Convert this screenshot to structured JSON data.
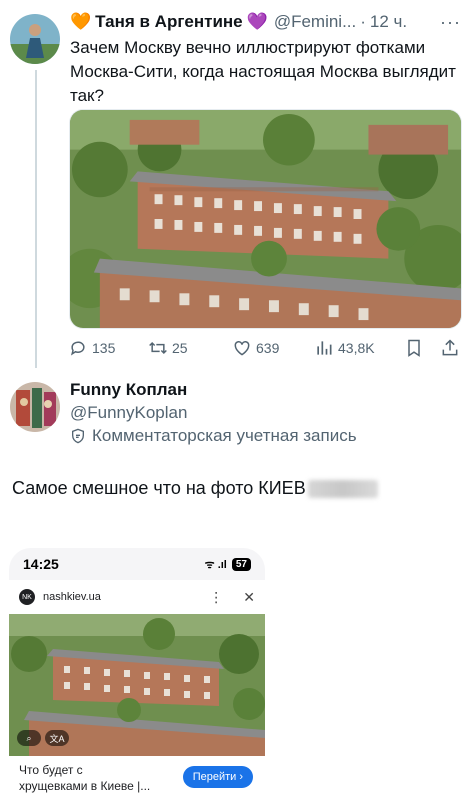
{
  "tweet1": {
    "emoji_left": "🧡",
    "display_name": "Таня в Аргентине",
    "emoji_right": "💜",
    "handle": "@Femini...",
    "separator": "·",
    "time": "12 ч.",
    "more_label": "···",
    "text": "Зачем Москву вечно иллюстрируют фотками Москва-Сити, когда настоящая Москва выглядит так?",
    "stats": {
      "replies": "135",
      "retweets": "25",
      "likes": "639",
      "views": "43,8K"
    }
  },
  "tweet2": {
    "display_name": "Funny Коплан",
    "handle": "@FunnyKoplan",
    "account_label": "Комментаторская учетная запись",
    "text": "Самое смешное что на фото КИЕВ"
  },
  "phone": {
    "time": "14:25",
    "signal": "ᯤ .ıl",
    "battery": "57",
    "site": "nashkiev.ua",
    "favicon_text": "NK",
    "more_label": "⋮",
    "close_label": "✕",
    "lens_label": "⌕",
    "translate_label": "文A",
    "result_title_line1": "Что будет с",
    "result_title_line2": "хрущевками в Киеве |...",
    "go_button": "Перейти ›"
  },
  "colors": {
    "accent": "#1a73e8",
    "muted": "#536471",
    "text": "#0f1419"
  },
  "icons": [
    "reply-icon",
    "retweet-icon",
    "like-icon",
    "views-icon",
    "bookmark-icon",
    "share-icon",
    "shield-icon"
  ]
}
